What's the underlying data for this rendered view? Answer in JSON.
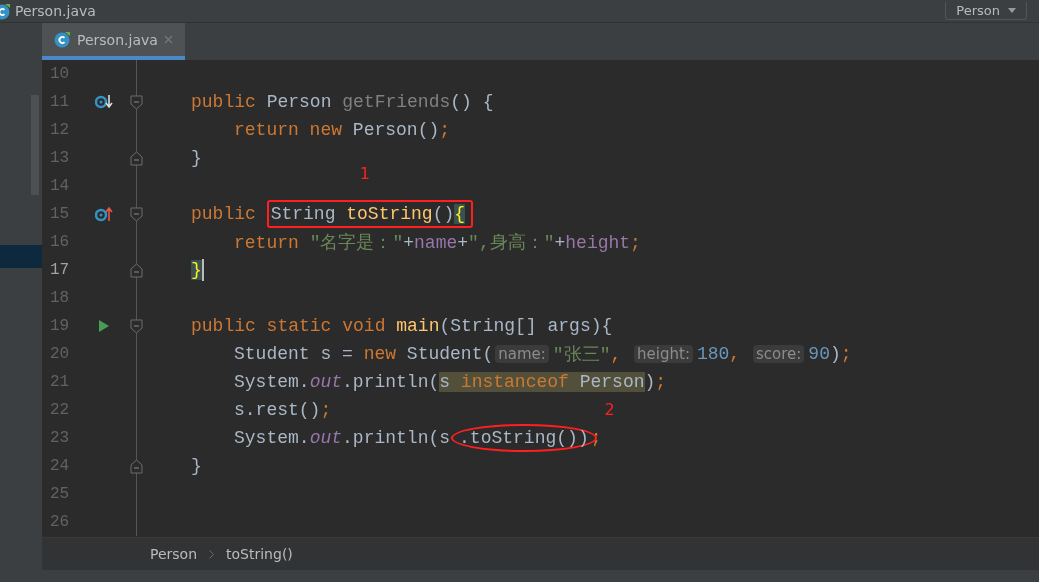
{
  "window": {
    "title": "Person.java",
    "navigator": "Person"
  },
  "tabs": [
    {
      "label": "Person.java",
      "selected": true
    }
  ],
  "editor": {
    "lines": [
      {
        "number": "10",
        "current": false
      },
      {
        "number": "11",
        "current": false,
        "gutter": {
          "kind": "implemented"
        },
        "fold": {
          "kind": "start"
        },
        "tokens": [
          {
            "kind": "kw",
            "text": "public "
          },
          {
            "kind": "plain",
            "text": "Person "
          },
          {
            "kind": "unused",
            "text": "getFriends"
          },
          {
            "kind": "plain",
            "text": "() {"
          }
        ],
        "children": [
          {
            "number": "12",
            "current": false,
            "tokens": [
              {
                "kind": "kw",
                "text": "return new "
              },
              {
                "kind": "plain",
                "text": "Person()"
              },
              {
                "kind": "kw",
                "text": ";"
              }
            ]
          }
        ]
      },
      {
        "number": "13",
        "current": false,
        "fold": {
          "kind": "end"
        },
        "tokens": [
          {
            "kind": "plain",
            "text": "}"
          }
        ]
      },
      {
        "number": "14",
        "current": false
      },
      {
        "number": "15",
        "current": false,
        "gutter": {
          "kind": "overrides"
        },
        "fold": {
          "kind": "start"
        },
        "tokens": [
          {
            "kind": "kw",
            "text": "public "
          },
          {
            "kind": "box",
            "label": "1",
            "tokens": [
              {
                "kind": "plain",
                "text": "String "
              },
              {
                "kind": "method",
                "text": "toString"
              },
              {
                "kind": "plain",
                "text": "()"
              },
              {
                "kind": "brace",
                "text": "{"
              }
            ]
          }
        ],
        "children": [
          {
            "number": "16",
            "current": false,
            "tokens": [
              {
                "kind": "kw",
                "text": "return "
              },
              {
                "kind": "str",
                "text": "\"名字是：\""
              },
              {
                "kind": "plain",
                "text": "+"
              },
              {
                "kind": "field",
                "text": "name"
              },
              {
                "kind": "plain",
                "text": "+"
              },
              {
                "kind": "str",
                "text": "\",身高：\""
              },
              {
                "kind": "plain",
                "text": "+"
              },
              {
                "kind": "field",
                "text": "height"
              },
              {
                "kind": "kw",
                "text": ";"
              }
            ]
          }
        ]
      },
      {
        "number": "17",
        "current": true,
        "fold": {
          "kind": "end"
        },
        "tokens": [
          {
            "kind": "brace",
            "text": "}"
          }
        ]
      },
      {
        "number": "18",
        "current": false
      },
      {
        "number": "19",
        "current": false,
        "gutter": {
          "kind": "run"
        },
        "fold": {
          "kind": "start"
        },
        "tokens": [
          {
            "kind": "kw",
            "text": "public static void "
          },
          {
            "kind": "method",
            "text": "main"
          },
          {
            "kind": "plain",
            "text": "(String[] args){"
          }
        ],
        "children": [
          {
            "number": "20",
            "current": false,
            "tokens": [
              {
                "kind": "plain",
                "text": "Student s = "
              },
              {
                "kind": "kw",
                "text": "new "
              },
              {
                "kind": "plain",
                "text": "Student("
              },
              {
                "kind": "hint",
                "text": "name:"
              },
              {
                "kind": "str",
                "text": "\"张三\""
              },
              {
                "kind": "kw",
                "text": ", "
              },
              {
                "kind": "hint",
                "text": "height:"
              },
              {
                "kind": "num",
                "text": "180"
              },
              {
                "kind": "kw",
                "text": ", "
              },
              {
                "kind": "hint",
                "text": "score:"
              },
              {
                "kind": "num",
                "text": "90"
              },
              {
                "kind": "plain",
                "text": ")"
              },
              {
                "kind": "kw",
                "text": ";"
              }
            ]
          },
          {
            "number": "21",
            "current": false,
            "tokens": [
              {
                "kind": "plain",
                "text": "System."
              },
              {
                "kind": "static",
                "text": "out"
              },
              {
                "kind": "plain",
                "text": ".println("
              },
              {
                "kind": "highlight",
                "tokens": [
                  {
                    "kind": "plain",
                    "text": "s "
                  },
                  {
                    "kind": "kw",
                    "text": "instanceof "
                  },
                  {
                    "kind": "plain",
                    "text": "Person"
                  }
                ]
              },
              {
                "kind": "plain",
                "text": ")"
              },
              {
                "kind": "kw",
                "text": ";"
              }
            ]
          },
          {
            "number": "22",
            "current": false,
            "tokens": [
              {
                "kind": "plain",
                "text": "s.rest()"
              },
              {
                "kind": "kw",
                "text": ";"
              }
            ]
          },
          {
            "number": "23",
            "current": false,
            "tokens": [
              {
                "kind": "plain",
                "text": "System."
              },
              {
                "kind": "static",
                "text": "out"
              },
              {
                "kind": "plain",
                "text": ".println(s"
              },
              {
                "kind": "ellipse",
                "label": "2",
                "tokens": [
                  {
                    "kind": "plain",
                    "text": ".toString())"
                  }
                ]
              },
              {
                "kind": "kw",
                "text": ";"
              }
            ]
          }
        ]
      },
      {
        "number": "24",
        "current": false,
        "fold": {
          "kind": "end"
        },
        "tokens": [
          {
            "kind": "plain",
            "text": "}"
          }
        ]
      },
      {
        "number": "25",
        "current": false
      },
      {
        "number": "26",
        "current": false
      }
    ]
  },
  "breadcrumbs": [
    {
      "label": "Person"
    },
    {
      "label": "toString()"
    }
  ]
}
